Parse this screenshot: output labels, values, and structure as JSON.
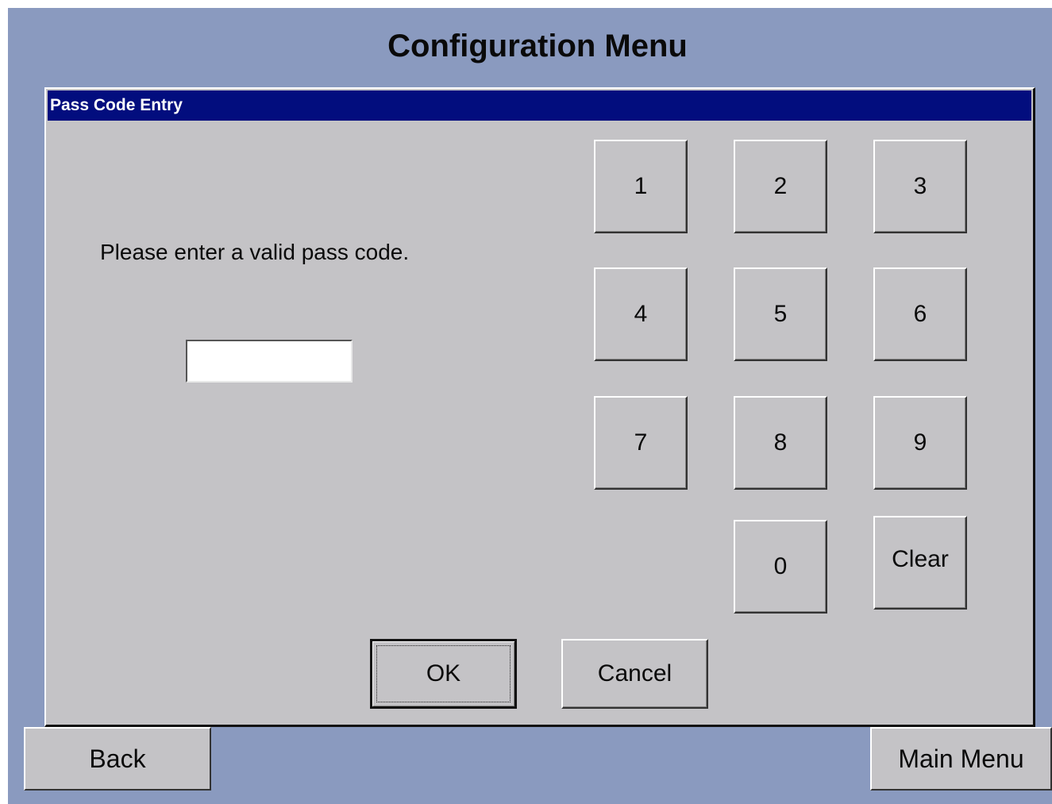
{
  "screen": {
    "title": "Configuration Menu"
  },
  "dialog": {
    "title": "Pass Code Entry",
    "prompt": "Please enter a valid pass code.",
    "passcode_value": "",
    "keypad": {
      "k1": "1",
      "k2": "2",
      "k3": "3",
      "k4": "4",
      "k5": "5",
      "k6": "6",
      "k7": "7",
      "k8": "8",
      "k9": "9",
      "k0": "0",
      "clear": "Clear"
    },
    "ok_label": "OK",
    "cancel_label": "Cancel"
  },
  "nav": {
    "back_label": "Back",
    "main_menu_label": "Main Menu"
  },
  "colors": {
    "background": "#8a9abf",
    "dialog_face": "#c4c3c6",
    "titlebar": "#020d7e"
  }
}
